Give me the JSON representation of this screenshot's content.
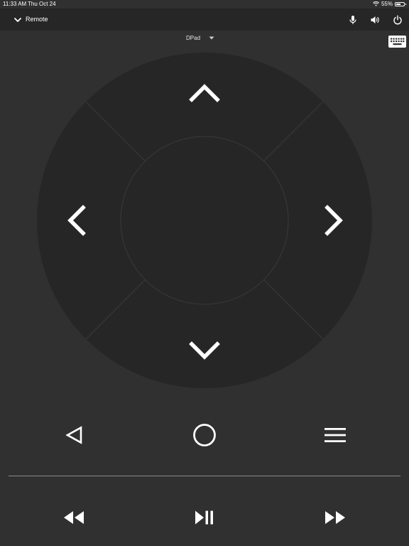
{
  "status_bar": {
    "time": "11:33 AM",
    "date": "Thu Oct 24",
    "battery_text": "55%",
    "battery_level": 0.55,
    "icons": [
      "wifi-icon",
      "battery-icon"
    ]
  },
  "app_bar": {
    "title": "Remote",
    "back_icon": "chevron-down-icon",
    "actions": [
      "microphone-icon",
      "volume-icon",
      "power-icon"
    ]
  },
  "mode_selector": {
    "selected": "DPad",
    "icon": "dropdown-triangle-icon"
  },
  "keyboard_button": {
    "icon": "keyboard-icon"
  },
  "dpad": {
    "buttons": [
      "up-arrow-icon",
      "left-arrow-icon",
      "right-arrow-icon",
      "down-arrow-icon",
      "center-select"
    ],
    "ring_color": "#262626",
    "center_color": "#262626",
    "line_color": "#3a3a3a"
  },
  "nav_buttons": [
    "back-triangle-icon",
    "home-circle-icon",
    "menu-icon"
  ],
  "media_buttons": [
    "rewind-icon",
    "play-pause-icon",
    "fast-forward-icon"
  ],
  "colors": {
    "background": "#303030",
    "app_bar": "#262626",
    "foreground": "#ffffff"
  }
}
